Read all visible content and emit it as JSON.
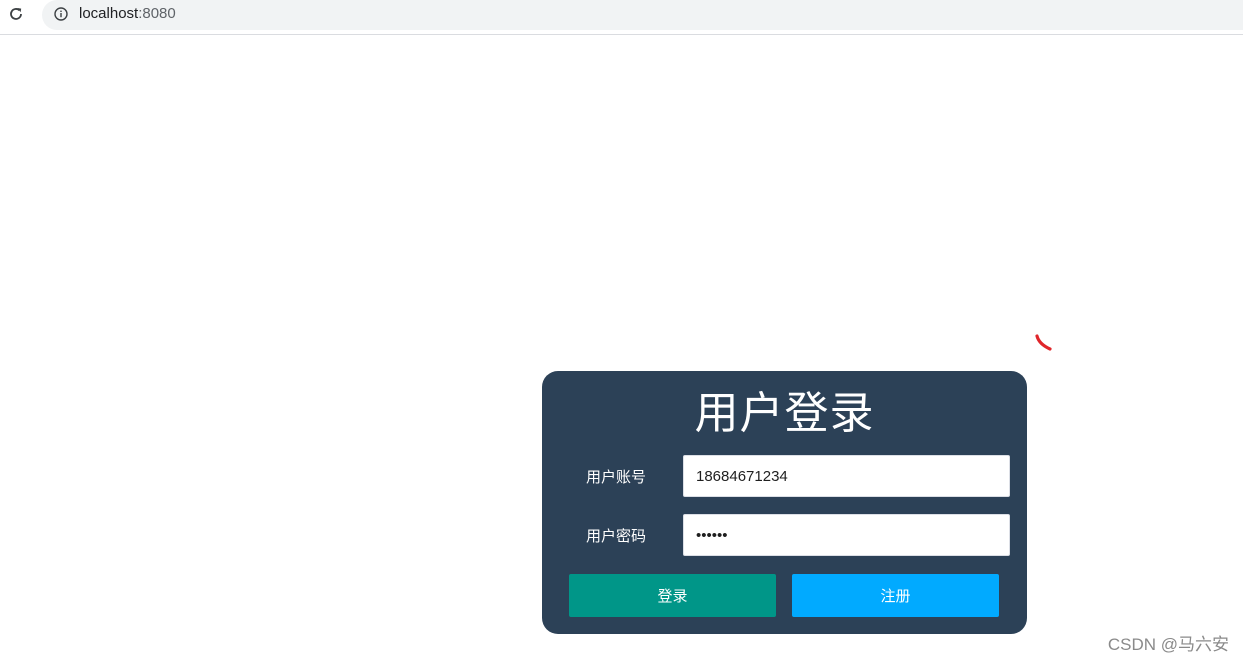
{
  "browser": {
    "reload_icon": "reload-icon",
    "info_icon": "info-icon",
    "url_host": "localhost",
    "url_port": ":8080"
  },
  "spinner": {
    "icon": "loading-spinner-icon",
    "color": "#e0262b"
  },
  "login": {
    "title": "用户登录",
    "account_label": "用户账号",
    "account_value": "18684671234",
    "password_label": "用户密码",
    "password_value": "123456",
    "login_button": "登录",
    "register_button": "注册",
    "card_color": "#2c4157",
    "login_color": "#009688",
    "register_color": "#01aaff"
  },
  "watermark": "CSDN @马六安"
}
